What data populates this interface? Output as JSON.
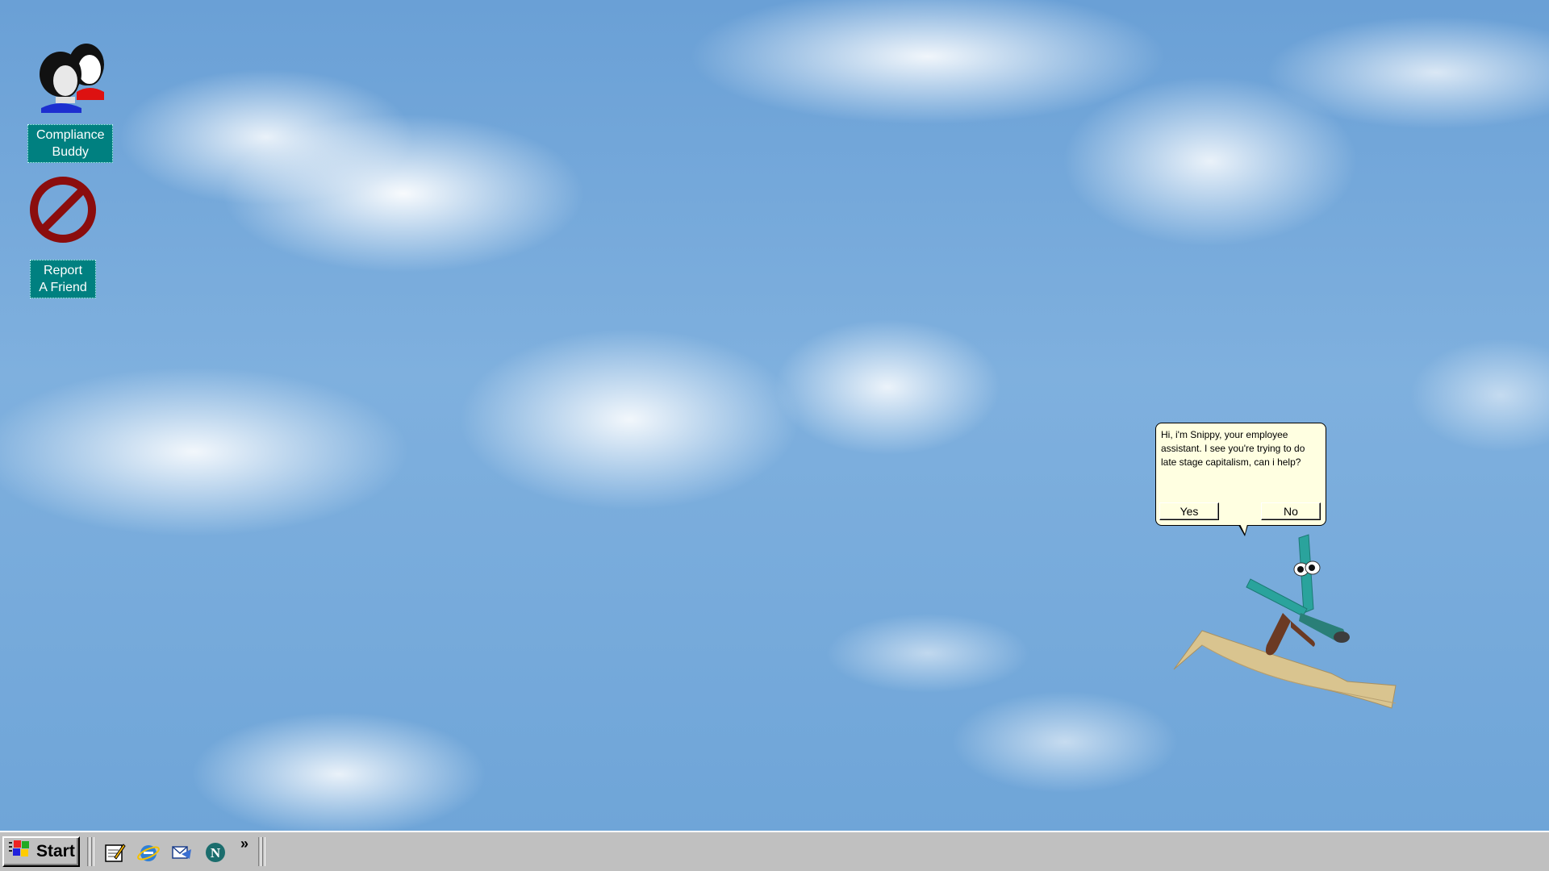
{
  "desktop": {
    "icons": [
      {
        "label": "Compliance\nBuddy",
        "icon": "people-icon"
      },
      {
        "label": "Report\nA Friend",
        "icon": "prohibited-icon"
      }
    ]
  },
  "assistant": {
    "name": "Snippy",
    "message": "Hi, i'm Snippy, your employee assistant. I see you're trying to do late stage capitalism, can i help?",
    "yes_label": "Yes",
    "no_label": "No",
    "balloon_color": "#ffffe1",
    "character_color": "#2aa39c"
  },
  "taskbar": {
    "start_label": "Start",
    "quick_launch": [
      {
        "icon": "notepad-icon"
      },
      {
        "icon": "internet-explorer-icon"
      },
      {
        "icon": "outlook-express-icon"
      },
      {
        "icon": "netscape-icon"
      }
    ],
    "overflow_label": "»"
  },
  "colors": {
    "icon_label_bg": "#008080",
    "taskbar_bg": "#c0c0c0",
    "sky": "#7fb0de"
  }
}
